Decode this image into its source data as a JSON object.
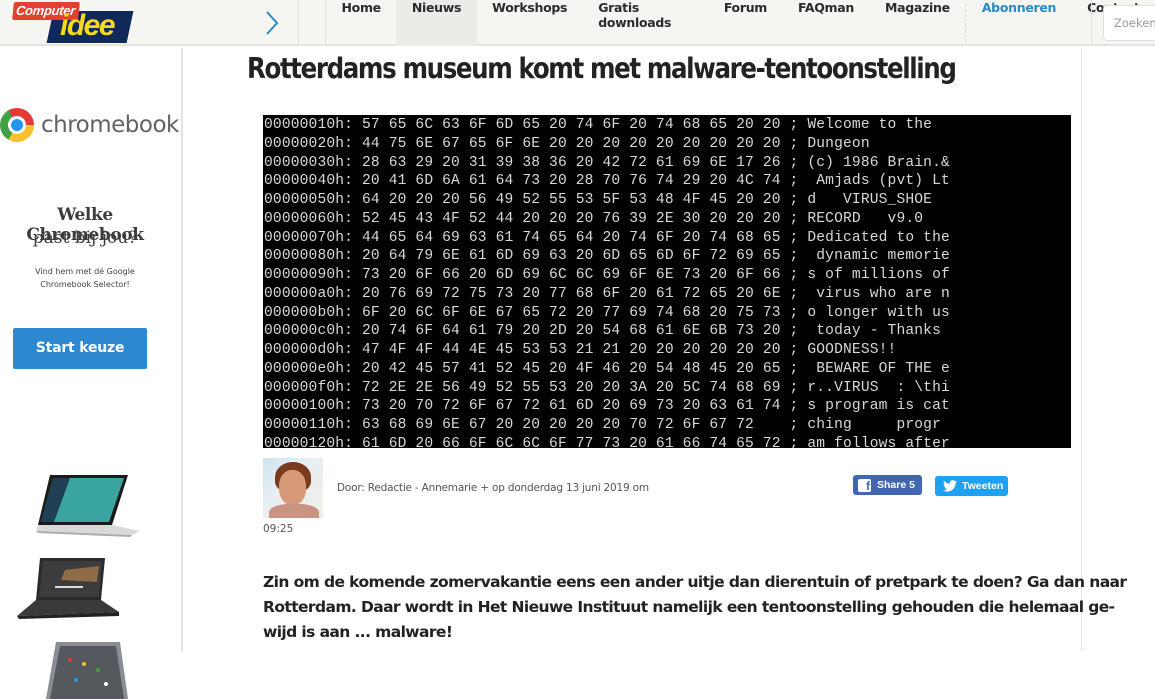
{
  "brand": {
    "logo_top": "Computer",
    "logo_bottom": "idee"
  },
  "nav": {
    "items": [
      {
        "label": "Home",
        "active": false
      },
      {
        "label": "Nieuws",
        "active": true
      },
      {
        "label": "Workshops",
        "active": false
      },
      {
        "label": "Gratis downloads",
        "active": false
      },
      {
        "label": "Forum",
        "active": false
      },
      {
        "label": "FAQman",
        "active": false
      },
      {
        "label": "Magazine",
        "active": false
      },
      {
        "label": "Abonneren",
        "active": false,
        "accent": true
      },
      {
        "label": "Contact",
        "active": false
      }
    ],
    "search_placeholder": "Zoeken",
    "accent_color": "#2c8ac7"
  },
  "ad": {
    "brand_word": "chromebook",
    "headline_1": "Welke Chromebook",
    "headline_2": "past bij jou?",
    "small_line_1": "Vind hem met dé Google",
    "small_line_2": "Chromebook Selector!",
    "button_label": "Start keuze",
    "button_color": "#2d88d0"
  },
  "article": {
    "title": "Rotterdams museum komt met malware-tentoonstelling",
    "hexdump": [
      {
        "offset": "00000010h:",
        "bytes": "57 65 6C 63 6F 6D 65 20 74 6F 20 74 68 65 20 20",
        "ascii": "Welcome to the  "
      },
      {
        "offset": "00000020h:",
        "bytes": "44 75 6E 67 65 6F 6E 20 20 20 20 20 20 20 20 20",
        "ascii": "Dungeon         "
      },
      {
        "offset": "00000030h:",
        "bytes": "28 63 29 20 31 39 38 36 20 42 72 61 69 6E 17 26",
        "ascii": "(c) 1986 Brain.&"
      },
      {
        "offset": "00000040h:",
        "bytes": "20 41 6D 6A 61 64 73 20 28 70 76 74 29 20 4C 74",
        "ascii": " Amjads (pvt) Lt"
      },
      {
        "offset": "00000050h:",
        "bytes": "64 20 20 20 56 49 52 55 53 5F 53 48 4F 45 20 20",
        "ascii": "d   VIRUS_SHOE  "
      },
      {
        "offset": "00000060h:",
        "bytes": "52 45 43 4F 52 44 20 20 20 76 39 2E 30 20 20 20",
        "ascii": "RECORD   v9.0   "
      },
      {
        "offset": "00000070h:",
        "bytes": "44 65 64 69 63 61 74 65 64 20 74 6F 20 74 68 65",
        "ascii": "Dedicated to the"
      },
      {
        "offset": "00000080h:",
        "bytes": "20 64 79 6E 61 6D 69 63 20 6D 65 6D 6F 72 69 65",
        "ascii": " dynamic memorie"
      },
      {
        "offset": "00000090h:",
        "bytes": "73 20 6F 66 20 6D 69 6C 6C 69 6F 6E 73 20 6F 66",
        "ascii": "s of millions of"
      },
      {
        "offset": "000000a0h:",
        "bytes": "20 76 69 72 75 73 20 77 68 6F 20 61 72 65 20 6E",
        "ascii": " virus who are n"
      },
      {
        "offset": "000000b0h:",
        "bytes": "6F 20 6C 6F 6E 67 65 72 20 77 69 74 68 20 75 73",
        "ascii": "o longer with us"
      },
      {
        "offset": "000000c0h:",
        "bytes": "20 74 6F 64 61 79 20 2D 20 54 68 61 6E 6B 73 20",
        "ascii": " today - Thanks "
      },
      {
        "offset": "000000d0h:",
        "bytes": "47 4F 4F 44 4E 45 53 53 21 21 20 20 20 20 20 20",
        "ascii": "GOODNESS!!      "
      },
      {
        "offset": "000000e0h:",
        "bytes": "20 42 45 57 41 52 45 20 4F 46 20 54 48 45 20 65",
        "ascii": " BEWARE OF THE e"
      },
      {
        "offset": "000000f0h:",
        "bytes": "72 2E 2E 56 49 52 55 53 20 20 3A 20 5C 74 68 69",
        "ascii": "r..VIRUS  : \\thi"
      },
      {
        "offset": "00000100h:",
        "bytes": "73 20 70 72 6F 67 72 61 6D 20 69 73 20 63 61 74",
        "ascii": "s program is cat"
      },
      {
        "offset": "00000110h:",
        "bytes": "63 68 69 6E 67 20 20 20 20 20 70 72 6F 67 72 ",
        "ascii": "ching     progr"
      },
      {
        "offset": "00000120h:",
        "bytes": "61 6D 20 66 6F 6C 6C 6F 77 73 20 61 66 74 65 72",
        "ascii": "am follows after"
      }
    ],
    "byline": "Door: Redactie - Annemarie + op donderdag 13 juni 2019 om",
    "time": "09:25",
    "share": {
      "facebook_label": "Share 5",
      "facebook_color": "#4267b2",
      "twitter_label": "Tweeten",
      "twitter_color": "#1da1f2"
    },
    "lead_lines": [
      "Zin om de komende zomervakantie eens een ander uitje dan dierentuin of pretpark te doen? Ga dan naar",
      "Rotterdam. Daar wordt in Het Nieuwe Instituut namelijk een tentoonstelling gehouden die helemaal ge-",
      "wijd is aan ... malware!"
    ]
  }
}
